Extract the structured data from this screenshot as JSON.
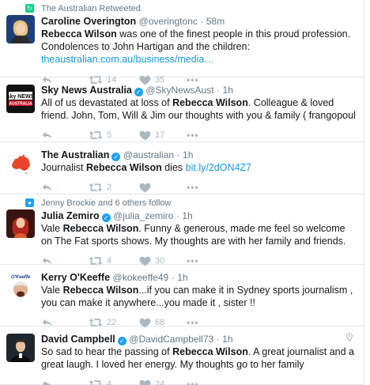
{
  "colors": {
    "accent": "#1da1f2",
    "retweet": "#19cf86",
    "muted": "#657786",
    "action": "#aab8c2",
    "link": "#1b95e0"
  },
  "tweets": [
    {
      "context": "The Australian Retweeted",
      "context_icon": "retweet-icon",
      "name": "Caroline Overington",
      "handle": "@overingtonc",
      "time": "58m",
      "text_bold": "Rebecca Wilson",
      "text_after": " was one of the finest people in this proud profession. Condolences to John Hartigan and the children:",
      "link": "theaustralian.com.au/business/media…",
      "retweets": "14",
      "likes": "35"
    },
    {
      "name": "Sky News Australia",
      "handle": "@SkyNewsAust",
      "time": "1h",
      "avatar_text_1": "sky NEWS",
      "avatar_text_2": "AUSTRALIA",
      "text_before": "All of us  devastated at loss of ",
      "text_bold": "Rebecca Wilson",
      "text_after": ". Colleague & loved friend. John, Tom, Will & Jim our thoughts with you & family ( frangopoul",
      "retweets": "5",
      "likes": "17"
    },
    {
      "name": "The Australian",
      "handle": "@australian",
      "time": "1h",
      "text_before": "Journalist ",
      "text_bold": "Rebecca Wilson",
      "text_after": " dies ",
      "link": "bit.ly/2dON4Z7",
      "retweets": "2",
      "likes": ""
    },
    {
      "context": "Jenny Brockie and 6 others follow",
      "context_icon": "follow-icon",
      "name": "Julia Zemiro",
      "handle": "@julia_zemiro",
      "time": "1h",
      "text_before": "Vale ",
      "text_bold": "Rebecca Wilson",
      "text_after": ". Funny & generous, made me feel so welcome on The Fat sports shows. My thoughts are with her family and friends.",
      "retweets": "4",
      "likes": "30"
    },
    {
      "name": "Kerry O'Keeffe",
      "handle": "@kokeeffe49",
      "time": "1h",
      "avatar_text_1": "O'Keeffe",
      "text_before": "Vale ",
      "text_bold": "Rebecca Wilson",
      "text_after": "...if you can make it in Sydney sports journalism , you can make it anywhere...you made it , sister !!",
      "retweets": "22",
      "likes": "68"
    },
    {
      "name": "David Campbell",
      "handle": "@DavidCampbell73",
      "time": "1h",
      "text_before": "So sad to hear the passing of ",
      "text_bold": "Rebecca Wilson",
      "text_after": ". A great journalist and a great laugh. I loved her energy. My thoughts go to her family",
      "retweets": "4",
      "likes": "24"
    }
  ],
  "separator": "·",
  "more_glyph": "•••"
}
